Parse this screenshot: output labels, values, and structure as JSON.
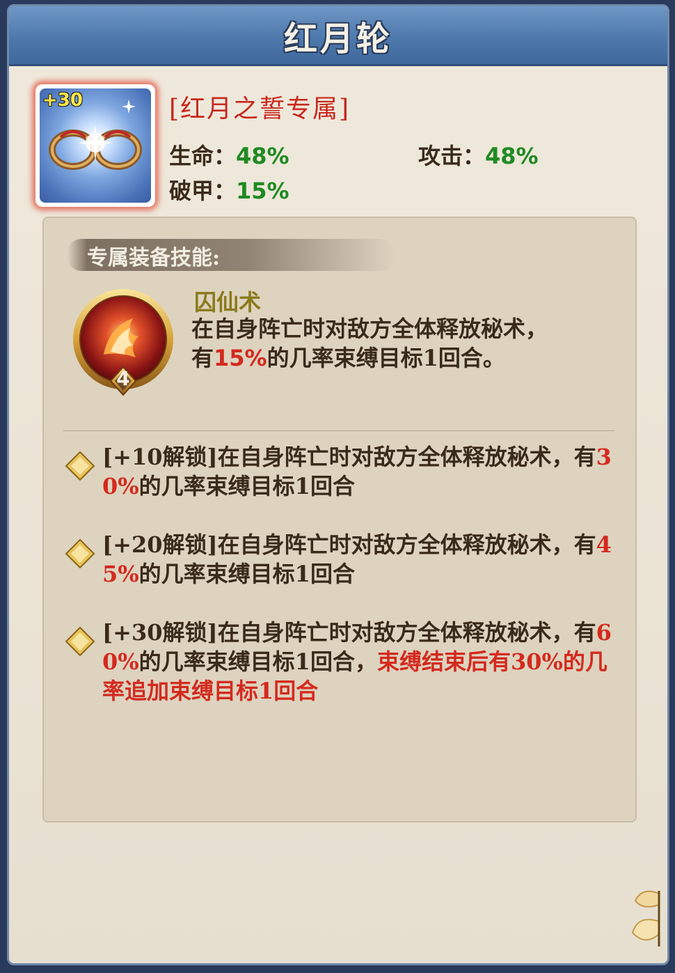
{
  "header": {
    "title": "红月轮"
  },
  "item": {
    "level_badge": "+30",
    "exclusive_title": "[红月之誓专属]",
    "stats": [
      {
        "label": "生命：",
        "value": "48%"
      },
      {
        "label": "攻击：",
        "value": "48%"
      },
      {
        "label": "破甲：",
        "value": "15%"
      }
    ]
  },
  "skill": {
    "section_label": "专属装备技能:",
    "emblem_level": "4",
    "name": "囚仙术",
    "desc_line1": "在自身阵亡时对敌方全体释放秘术，",
    "desc_line2_pre": "有",
    "desc_line2_red": "15%",
    "desc_line2_post": "的几率束缚目标1回合。"
  },
  "unlocks": [
    {
      "line1_pre": "[+10解锁]在自身阵亡时对敌方全体释放秘术，有",
      "line1_red": "3",
      "line2_red": "0%",
      "line2_post": "的几率束缚目标1回合"
    },
    {
      "line1_pre": "[+20解锁]在自身阵亡时对敌方全体释放秘术，有",
      "line1_red": "4",
      "line2_red": "5%",
      "line2_post": "的几率束缚目标1回合"
    },
    {
      "line1_pre": "[+30解锁]在自身阵亡时对敌方全体释放秘术，有",
      "line1_red": "6",
      "line2_red": "0%",
      "line2_post": "的几率束缚目标1回合，",
      "line2_red2": "束缚结束后有30%的几",
      "line3_red": "率追加束缚目标1回合"
    }
  ],
  "colors": {
    "header_blue": "#4e79ad",
    "highlight_red": "#d42a1e",
    "stat_green": "#1f8a22",
    "skill_name_olive": "#8a7a1a"
  }
}
